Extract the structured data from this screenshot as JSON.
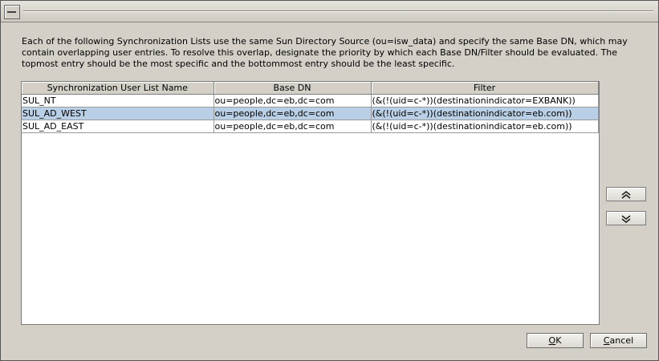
{
  "description": "Each of the following Synchronization Lists use the same Sun Directory Source (ou=isw_data) and specify the same Base DN, which may contain overlapping user entries. To resolve this overlap, designate the priority by which each Base DN/Filter should be evaluated.  The topmost entry should be the most specific and the bottommost entry should be the least specific.",
  "table": {
    "columns": [
      "Synchronization User List Name",
      "Base DN",
      "Filter"
    ],
    "rows": [
      {
        "name": "SUL_NT",
        "base_dn": "ou=people,dc=eb,dc=com",
        "filter": "(&(!(uid=c-*))(destinationindicator=EXBANK))",
        "selected": false
      },
      {
        "name": "SUL_AD_WEST",
        "base_dn": "ou=people,dc=eb,dc=com",
        "filter": "(&(!(uid=c-*))(destinationindicator=eb.com))",
        "selected": true
      },
      {
        "name": "SUL_AD_EAST",
        "base_dn": "ou=people,dc=eb,dc=com",
        "filter": "(&(!(uid=c-*))(destinationindicator=eb.com))",
        "selected": false
      }
    ]
  },
  "buttons": {
    "move_up_icon": "double-chevron-up-icon",
    "move_down_icon": "double-chevron-down-icon",
    "ok_mnemonic": "O",
    "ok_rest": "K",
    "cancel_mnemonic": "C",
    "cancel_rest": "ancel"
  },
  "colors": {
    "selection": "#b8cfe5",
    "window": "#d4d0c8"
  }
}
